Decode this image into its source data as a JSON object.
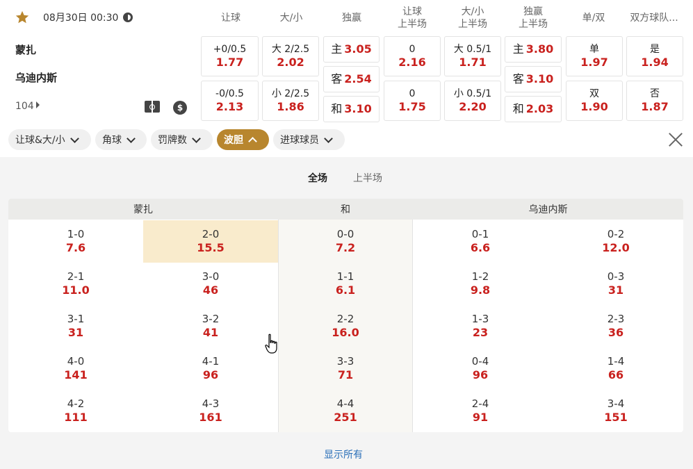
{
  "match": {
    "datetime": "08月30日 00:30",
    "home_team": "蒙扎",
    "away_team": "乌迪内斯",
    "market_count": "104"
  },
  "headers": {
    "handicap": "让球",
    "over_under": "大/小",
    "moneyline": "独赢",
    "handicap_h1_l1": "让球",
    "handicap_h1_l2": "上半场",
    "ou_h1_l1": "大/小",
    "ou_h1_l2": "上半场",
    "ml_h1_l1": "独赢",
    "ml_h1_l2": "上半场",
    "odd_even": "单/双",
    "btts": "双方球队..."
  },
  "odds": {
    "handicap": [
      {
        "label": "+0/0.5",
        "value": "1.77"
      },
      {
        "label": "-0/0.5",
        "value": "2.13"
      }
    ],
    "over_under": [
      {
        "label": "大 2/2.5",
        "value": "2.02"
      },
      {
        "label": "小 2/2.5",
        "value": "1.86"
      }
    ],
    "moneyline": [
      {
        "label": "主",
        "value": "3.05"
      },
      {
        "label": "客",
        "value": "2.54"
      },
      {
        "label": "和",
        "value": "3.10"
      }
    ],
    "handicap_h1": [
      {
        "label": "0",
        "value": "2.16"
      },
      {
        "label": "0",
        "value": "1.75"
      }
    ],
    "ou_h1": [
      {
        "label": "大 0.5/1",
        "value": "1.71"
      },
      {
        "label": "小 0.5/1",
        "value": "2.20"
      }
    ],
    "ml_h1": [
      {
        "label": "主",
        "value": "3.80"
      },
      {
        "label": "客",
        "value": "3.10"
      },
      {
        "label": "和",
        "value": "2.03"
      }
    ],
    "odd_even": [
      {
        "label": "单",
        "value": "1.97"
      },
      {
        "label": "双",
        "value": "1.90"
      }
    ],
    "btts": [
      {
        "label": "是",
        "value": "1.94"
      },
      {
        "label": "否",
        "value": "1.87"
      }
    ]
  },
  "filters": [
    {
      "label": "让球&大/小",
      "active": false
    },
    {
      "label": "角球",
      "active": false
    },
    {
      "label": "罚牌数",
      "active": false
    },
    {
      "label": "波胆",
      "active": true
    },
    {
      "label": "进球球员",
      "active": false
    }
  ],
  "period_tabs": {
    "full": "全场",
    "first_half": "上半场",
    "selected": "全场"
  },
  "correct_score": {
    "home_header": "蒙扎",
    "draw_header": "和",
    "away_header": "乌迪内斯",
    "rows": [
      [
        {
          "score": "1-0",
          "odds": "7.6"
        },
        {
          "score": "2-0",
          "odds": "15.5"
        },
        {
          "score": "0-0",
          "odds": "7.2"
        },
        {
          "score": "0-1",
          "odds": "6.6"
        },
        {
          "score": "0-2",
          "odds": "12.0"
        }
      ],
      [
        {
          "score": "2-1",
          "odds": "11.0"
        },
        {
          "score": "3-0",
          "odds": "46"
        },
        {
          "score": "1-1",
          "odds": "6.1"
        },
        {
          "score": "1-2",
          "odds": "9.8"
        },
        {
          "score": "0-3",
          "odds": "31"
        }
      ],
      [
        {
          "score": "3-1",
          "odds": "31"
        },
        {
          "score": "3-2",
          "odds": "41"
        },
        {
          "score": "2-2",
          "odds": "16.0"
        },
        {
          "score": "1-3",
          "odds": "23"
        },
        {
          "score": "2-3",
          "odds": "36"
        }
      ],
      [
        {
          "score": "4-0",
          "odds": "141"
        },
        {
          "score": "4-1",
          "odds": "96"
        },
        {
          "score": "3-3",
          "odds": "71"
        },
        {
          "score": "0-4",
          "odds": "96"
        },
        {
          "score": "1-4",
          "odds": "66"
        }
      ],
      [
        {
          "score": "4-2",
          "odds": "111"
        },
        {
          "score": "4-3",
          "odds": "161"
        },
        {
          "score": "4-4",
          "odds": "251"
        },
        {
          "score": "2-4",
          "odds": "91"
        },
        {
          "score": "3-4",
          "odds": "151"
        }
      ]
    ],
    "highlighted": "2-0"
  },
  "show_all": "显示所有",
  "colors": {
    "odds_red": "#c9211e",
    "accent_gold": "#b8862e",
    "highlight": "#f9ebcc",
    "link_blue": "#2a6fb8"
  },
  "icons": [
    "star-icon",
    "clock-icon",
    "field-icon",
    "dollar-icon",
    "chevron-down-icon",
    "close-icon",
    "hand-cursor-icon"
  ]
}
